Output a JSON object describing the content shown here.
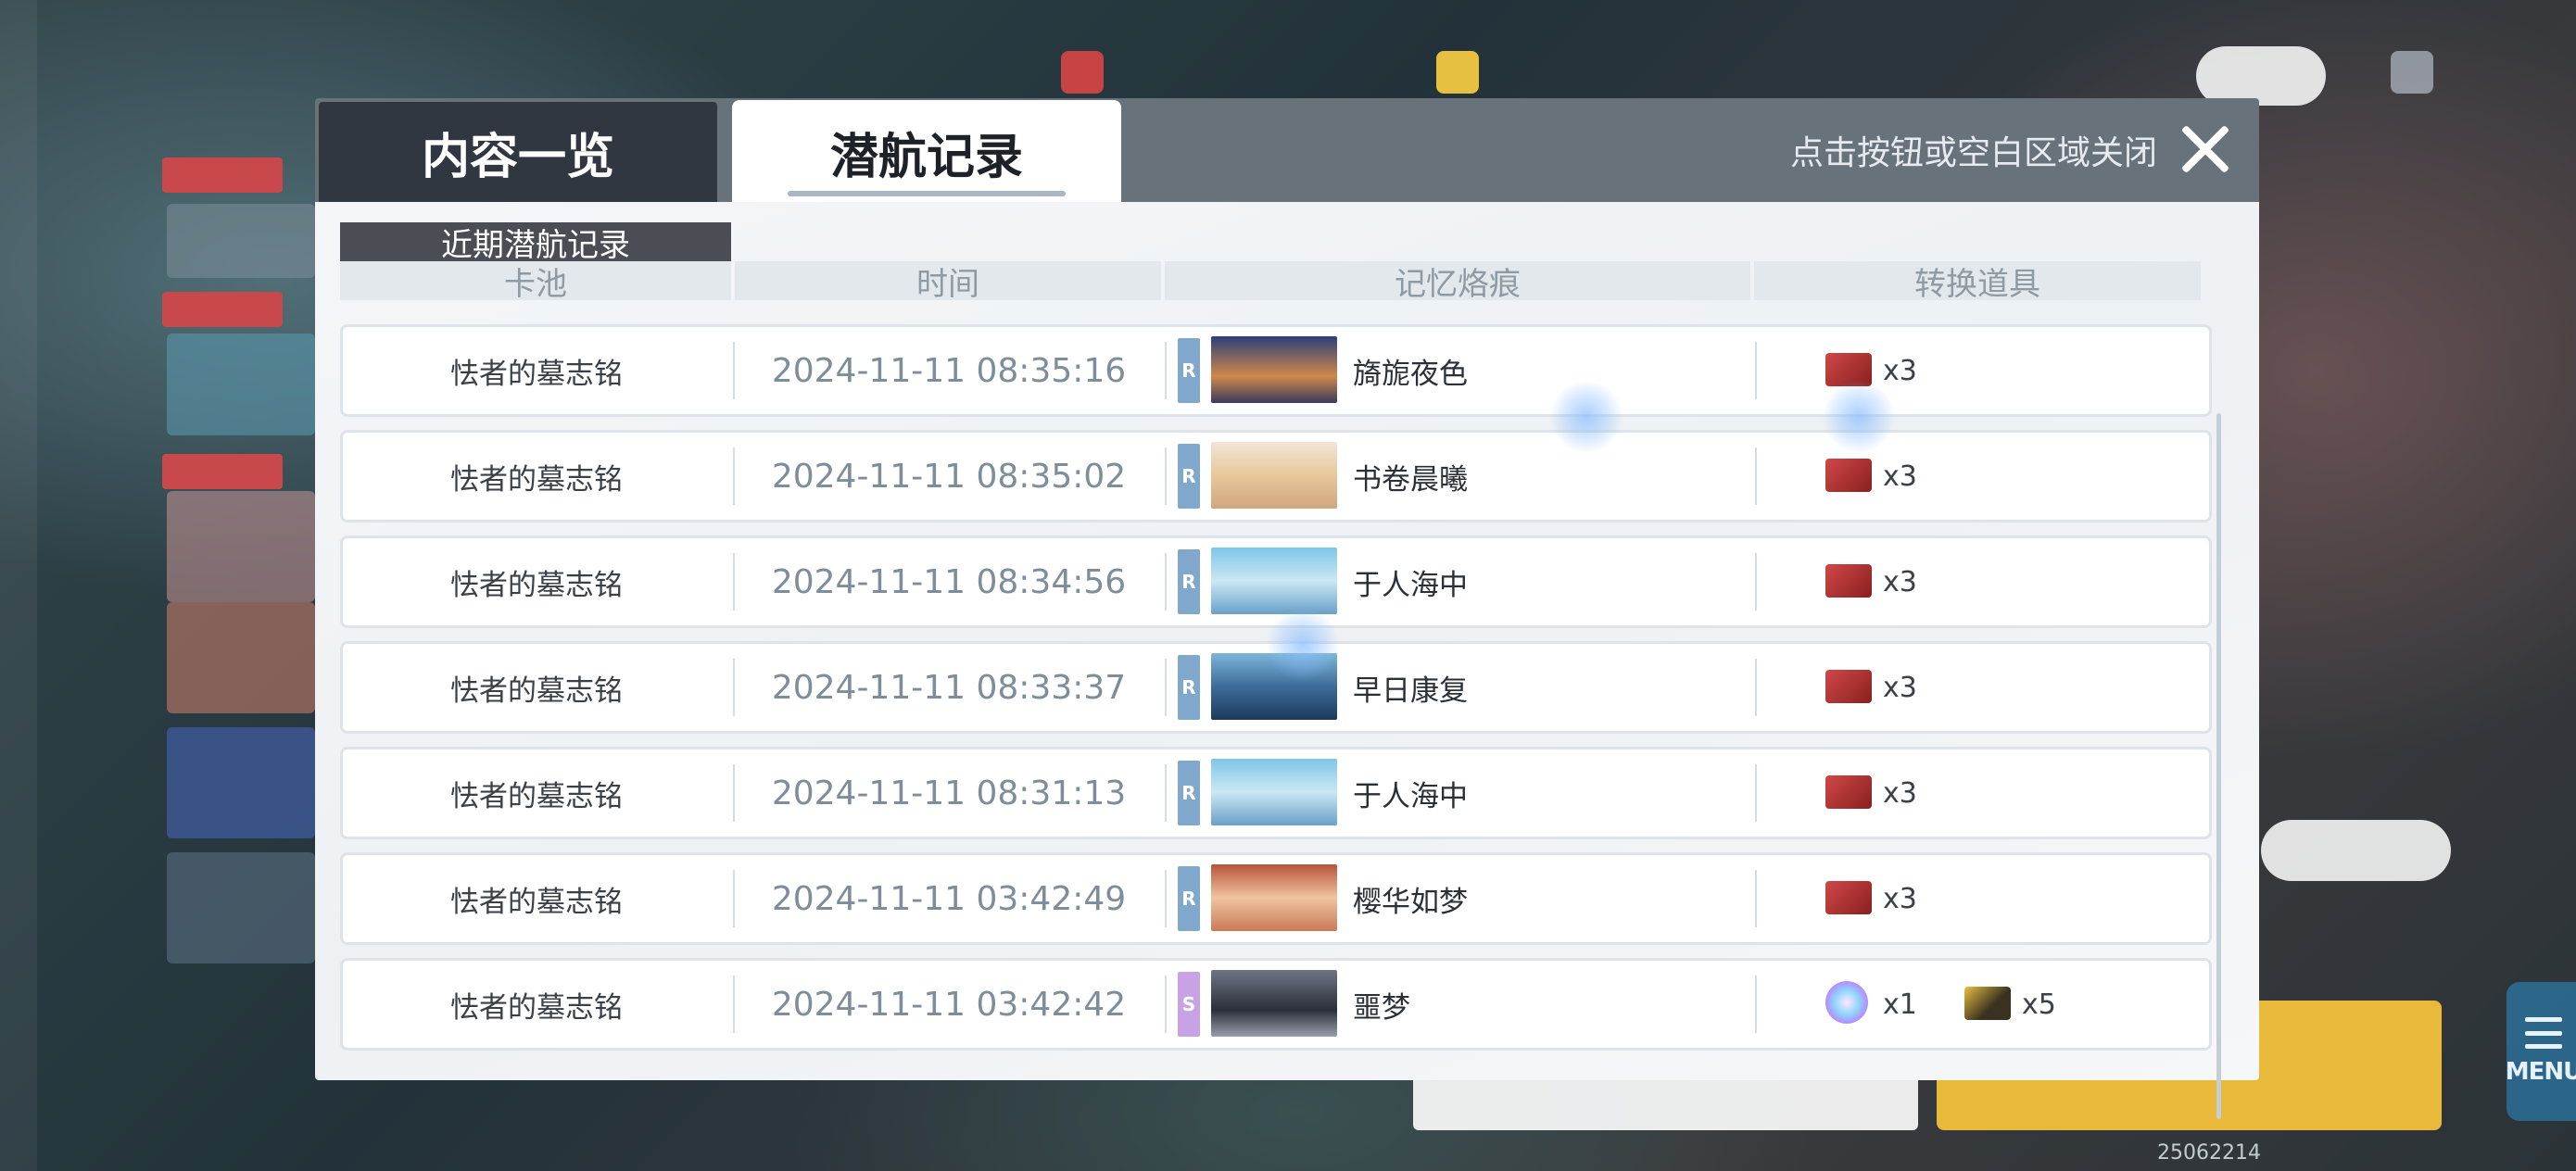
{
  "tabs": [
    {
      "label": "内容一览",
      "active": false
    },
    {
      "label": "潜航记录",
      "active": true
    }
  ],
  "close_hint": "点击按钮或空白区域关闭",
  "section_title": "近期潜航记录",
  "columns": {
    "pool": "卡池",
    "time": "时间",
    "memory": "记忆烙痕",
    "item": "转换道具"
  },
  "records": [
    {
      "pool": "怯者的墓志铭",
      "time": "2024-11-11  08:35:16",
      "rarity": "R",
      "memory": "旖旎夜色",
      "items": [
        {
          "icon": "red-ticket-icon",
          "count": "x3"
        }
      ]
    },
    {
      "pool": "怯者的墓志铭",
      "time": "2024-11-11  08:35:02",
      "rarity": "R",
      "memory": "书卷晨曦",
      "items": [
        {
          "icon": "red-ticket-icon",
          "count": "x3"
        }
      ]
    },
    {
      "pool": "怯者的墓志铭",
      "time": "2024-11-11  08:34:56",
      "rarity": "R",
      "memory": "于人海中",
      "items": [
        {
          "icon": "red-ticket-icon",
          "count": "x3"
        }
      ]
    },
    {
      "pool": "怯者的墓志铭",
      "time": "2024-11-11  08:33:37",
      "rarity": "R",
      "memory": "早日康复",
      "items": [
        {
          "icon": "red-ticket-icon",
          "count": "x3"
        }
      ]
    },
    {
      "pool": "怯者的墓志铭",
      "time": "2024-11-11  08:31:13",
      "rarity": "R",
      "memory": "于人海中",
      "items": [
        {
          "icon": "red-ticket-icon",
          "count": "x3"
        }
      ]
    },
    {
      "pool": "怯者的墓志铭",
      "time": "2024-11-11  03:42:49",
      "rarity": "R",
      "memory": "樱华如梦",
      "items": [
        {
          "icon": "red-ticket-icon",
          "count": "x3"
        }
      ]
    },
    {
      "pool": "怯者的墓志铭",
      "time": "2024-11-11  03:42:42",
      "rarity": "S",
      "memory": "噩梦",
      "items": [
        {
          "icon": "prism-orb-icon",
          "count": "x1"
        },
        {
          "icon": "gold-card-icon",
          "count": "x5"
        }
      ]
    }
  ],
  "colors": {
    "rarity_R": "#7fa8cc",
    "rarity_S": "#c7a3e6"
  },
  "menu_label": "MENU",
  "build_id": "25062214"
}
